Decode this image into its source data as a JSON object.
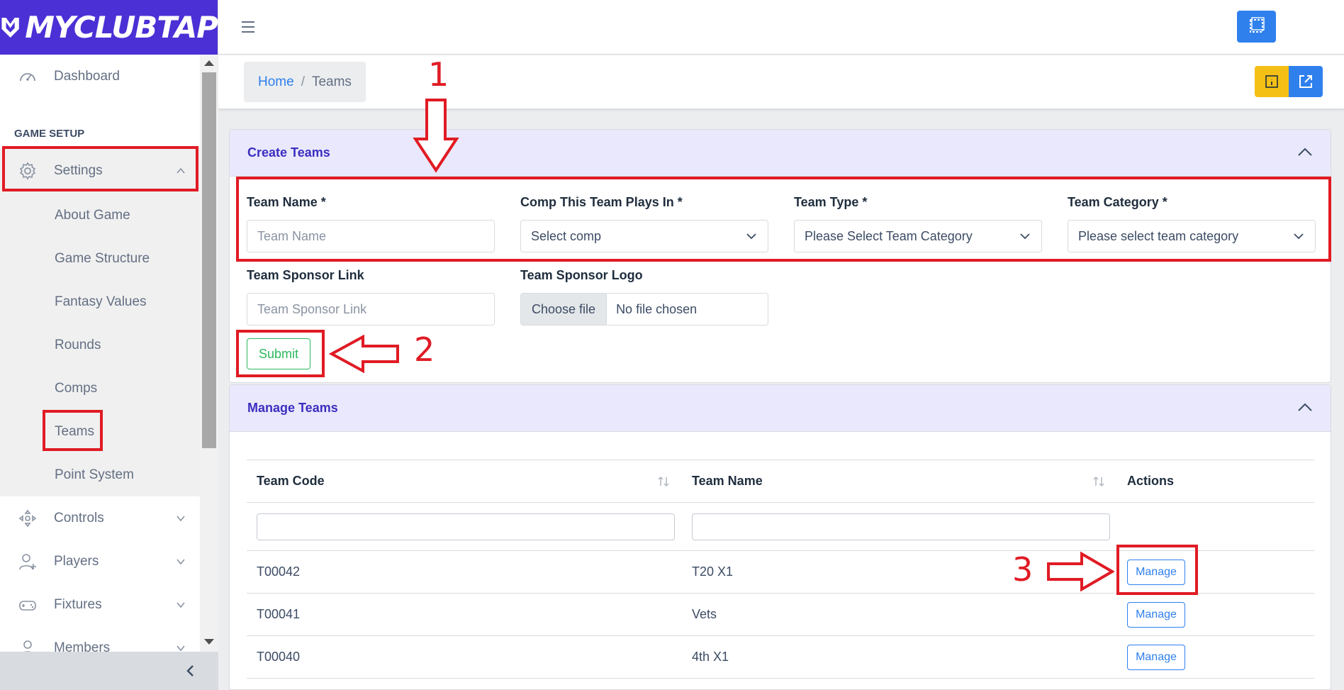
{
  "brand": {
    "name": "MYCLUBTAP"
  },
  "sidebar": {
    "dashboard": "Dashboard",
    "section_title": "GAME SETUP",
    "settings": "Settings",
    "settings_children": [
      "About Game",
      "Game Structure",
      "Fantasy Values",
      "Rounds",
      "Comps",
      "Teams",
      "Point System"
    ],
    "controls": "Controls",
    "players": "Players",
    "fixtures": "Fixtures",
    "members": "Members"
  },
  "breadcrumb": {
    "home": "Home",
    "separator": "/",
    "current": "Teams"
  },
  "create_card": {
    "title": "Create Teams",
    "team_name": {
      "label": "Team Name *",
      "placeholder": "Team Name"
    },
    "comp": {
      "label": "Comp This Team Plays In *",
      "value": "Select comp"
    },
    "team_type": {
      "label": "Team Type *",
      "value": "Please Select Team Category"
    },
    "team_category": {
      "label": "Team Category *",
      "value": "Please select team category"
    },
    "sponsor_link": {
      "label": "Team Sponsor Link",
      "placeholder": "Team Sponsor Link"
    },
    "sponsor_logo": {
      "label": "Team Sponsor Logo",
      "button": "Choose file",
      "status": "No file chosen"
    },
    "submit": "Submit"
  },
  "manage_card": {
    "title": "Manage Teams",
    "columns": [
      "Team Code",
      "Team Name",
      "Actions"
    ],
    "rows": [
      {
        "code": "T00042",
        "name": "T20 X1",
        "action": "Manage"
      },
      {
        "code": "T00041",
        "name": "Vets",
        "action": "Manage"
      },
      {
        "code": "T00040",
        "name": "4th X1",
        "action": "Manage"
      }
    ]
  },
  "annotations": {
    "step1": "1",
    "step2": "2",
    "step3": "3"
  },
  "colors": {
    "brand": "#4b30d6",
    "primary": "#2f80ed",
    "warning": "#f5c016",
    "success": "#2eb85c",
    "annotation": "#e01b24",
    "card_header": "#eae8fc"
  }
}
